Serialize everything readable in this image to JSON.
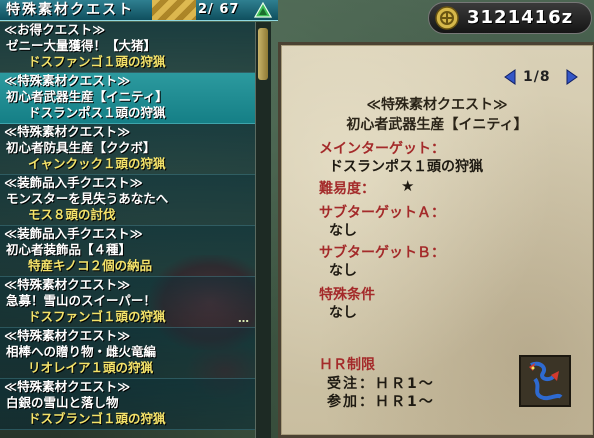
{
  "header": {
    "title": "特殊素材クエスト",
    "count": "2/ 67",
    "money": "3121416z"
  },
  "quests": [
    {
      "category": "≪お得クエスト≫",
      "name": "ゼニー大量獲得！【大猪】",
      "target": "ドスファンゴ１頭の狩猟",
      "selected": false
    },
    {
      "category": "≪特殊素材クエスト≫",
      "name": "初心者武器生産【イニティ】",
      "target": "ドスランポス１頭の狩猟",
      "selected": true
    },
    {
      "category": "≪特殊素材クエスト≫",
      "name": "初心者防具生産【ククボ】",
      "target": "イャンクック１頭の狩猟",
      "selected": false
    },
    {
      "category": "≪装飾品入手クエスト≫",
      "name": "モンスターを見失うあなたへ",
      "target": "モス８頭の討伐",
      "selected": false
    },
    {
      "category": "≪装飾品入手クエスト≫",
      "name": "初心者装飾品【４種】",
      "target": "特産キノコ２個の納品",
      "selected": false
    },
    {
      "category": "≪特殊素材クエスト≫",
      "name": "急募！雪山のスイーパー！",
      "target": "ドスファンゴ１頭の狩猟",
      "selected": false,
      "more": "…"
    },
    {
      "category": "≪特殊素材クエスト≫",
      "name": "相棒への贈り物・雌火竜編",
      "target": "リオレイア１頭の狩猟",
      "selected": false
    },
    {
      "category": "≪特殊素材クエスト≫",
      "name": "白銀の雪山と落し物",
      "target": "ドスブランゴ１頭の狩猟",
      "selected": false
    }
  ],
  "detail": {
    "page": "1/8",
    "category": "≪特殊素材クエスト≫",
    "name": "初心者武器生産【イニティ】",
    "main_target_label": "メインターゲット：",
    "main_target": "ドスランポス１頭の狩猟",
    "difficulty_label": "難易度：",
    "difficulty_star": "★",
    "sub_a_label": "サブターゲットＡ：",
    "sub_a": "なし",
    "sub_b_label": "サブターゲットＢ：",
    "sub_b": "なし",
    "special_label": "特殊条件",
    "special": "なし",
    "hr_title": "ＨＲ制限",
    "hr_accept": "受注：ＨＲ1〜",
    "hr_join": "参加：ＨＲ1〜"
  },
  "colors": {
    "selected_item": "#1f8d93",
    "target_text": "#f4e36a",
    "label_red": "#a42a2a",
    "parchment": "#d4c9ac"
  },
  "icons": [
    "triangle-icon",
    "coin-icon",
    "left-arrow-icon",
    "right-arrow-icon",
    "monster-icon"
  ]
}
